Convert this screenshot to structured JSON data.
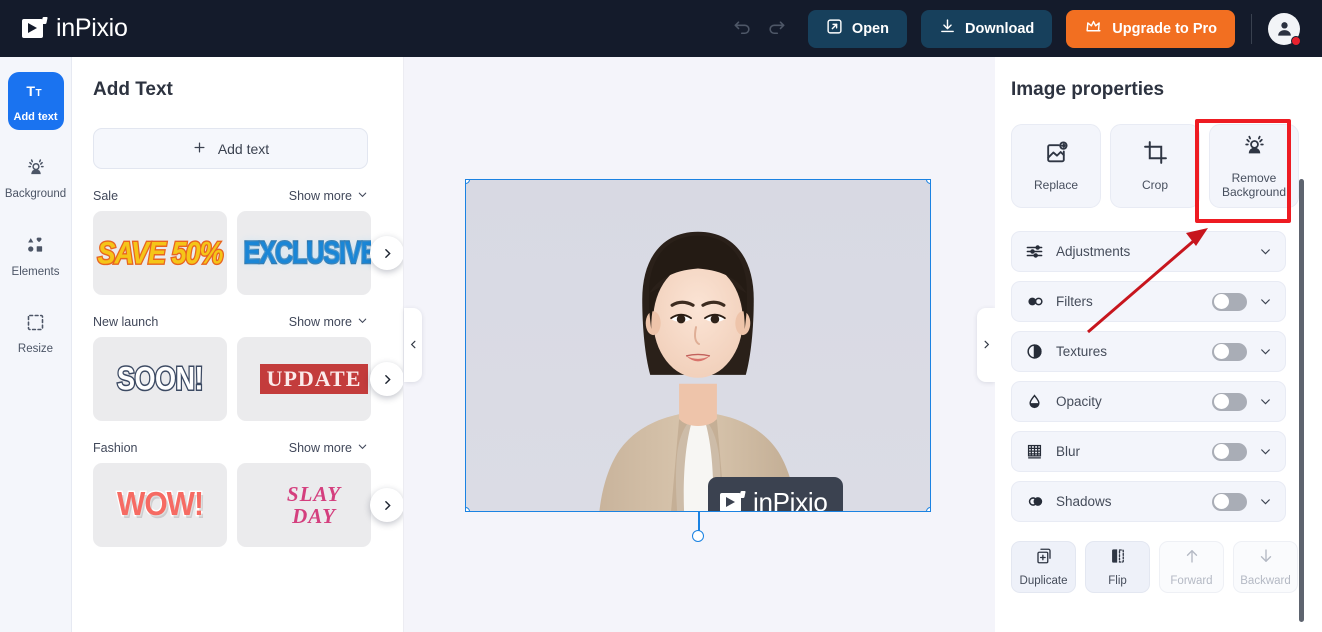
{
  "app": {
    "brand": "inPixio",
    "brand_logo_icon": "inpixio-play-logo-icon"
  },
  "header": {
    "undo_icon": "undo-arrow-icon",
    "redo_icon": "redo-arrow-icon",
    "open_label": "Open",
    "open_icon": "external-link-icon",
    "download_label": "Download",
    "download_icon": "download-icon",
    "upgrade_label": "Upgrade to Pro",
    "upgrade_icon": "crown-icon",
    "avatar_icon": "user-avatar-icon",
    "accent_orange": "#f26f21",
    "button_dark": "#17405c",
    "bar_color": "#141b2b"
  },
  "rail": {
    "items": [
      {
        "label": "Add text",
        "icon": "text-tt-icon",
        "active": true
      },
      {
        "label": "Background",
        "icon": "background-person-icon",
        "active": false
      },
      {
        "label": "Elements",
        "icon": "shapes-elements-icon",
        "active": false
      },
      {
        "label": "Resize",
        "icon": "resize-crop-icon",
        "active": false
      }
    ]
  },
  "left_panel": {
    "title": "Add Text",
    "add_text_button": "Add text",
    "add_text_icon": "plus-icon",
    "show_more_label": "Show more",
    "show_more_icon": "chevron-down-icon",
    "carousel_next_icon": "chevron-right-icon",
    "categories": [
      {
        "name": "Sale",
        "thumbs": [
          {
            "text": "SAVE 50%",
            "style": "wa-save"
          },
          {
            "text": "EXCLUSIVE",
            "style": "wa-excl"
          }
        ]
      },
      {
        "name": "New launch",
        "thumbs": [
          {
            "text": "SOON!",
            "style": "wa-soon"
          },
          {
            "text": "UPDATE",
            "style": "wa-update"
          }
        ]
      },
      {
        "name": "Fashion",
        "thumbs": [
          {
            "text": "WOW!",
            "style": "wa-wow"
          },
          {
            "text": "SLAY\nDAY",
            "style": "wa-slay"
          }
        ]
      }
    ]
  },
  "canvas": {
    "collapse_left_icon": "chevron-left-icon",
    "collapse_right_icon": "chevron-right-icon",
    "background_color": "#f4f4fa",
    "selection": {
      "selected": true,
      "border_color": "#1a82e2",
      "handle_icon": "resize-handle-icon",
      "rotate_handle_icon": "rotate-handle-icon"
    },
    "watermark": "inPixio",
    "image_description": "portrait photo of a woman in a beige blazer on a light gray background"
  },
  "right_panel": {
    "title": "Image properties",
    "tools": [
      {
        "label": "Replace",
        "icon": "replace-image-icon"
      },
      {
        "label": "Crop",
        "icon": "crop-icon"
      },
      {
        "label": "Remove\nBackground",
        "icon": "remove-background-icon",
        "highlighted": true
      }
    ],
    "properties": [
      {
        "label": "Adjustments",
        "icon": "sliders-icon",
        "toggle": false,
        "chevron": "chevron-down-icon"
      },
      {
        "label": "Filters",
        "icon": "filters-circles-icon",
        "toggle": true,
        "toggle_on": false,
        "chevron": "chevron-down-icon"
      },
      {
        "label": "Textures",
        "icon": "textures-half-circle-icon",
        "toggle": true,
        "toggle_on": false,
        "chevron": "chevron-down-icon"
      },
      {
        "label": "Opacity",
        "icon": "opacity-droplet-icon",
        "toggle": true,
        "toggle_on": false,
        "chevron": "chevron-down-icon"
      },
      {
        "label": "Blur",
        "icon": "blur-grid-icon",
        "toggle": true,
        "toggle_on": false,
        "chevron": "chevron-down-icon"
      },
      {
        "label": "Shadows",
        "icon": "shadows-overlap-icon",
        "toggle": true,
        "toggle_on": false,
        "chevron": "chevron-down-icon"
      }
    ],
    "actions": [
      {
        "label": "Duplicate",
        "icon": "duplicate-icon",
        "enabled": true
      },
      {
        "label": "Flip",
        "icon": "flip-horizontal-icon",
        "enabled": true
      },
      {
        "label": "Forward",
        "icon": "arrow-up-icon",
        "enabled": false
      },
      {
        "label": "Backward",
        "icon": "arrow-down-icon",
        "enabled": false
      }
    ],
    "scrollbar": "vertical-scrollbar"
  },
  "annotation": {
    "highlight_color": "#ee1b22",
    "target": "Remove Background",
    "shape": "red rectangle with arrow pointing at the Remove Background button"
  }
}
